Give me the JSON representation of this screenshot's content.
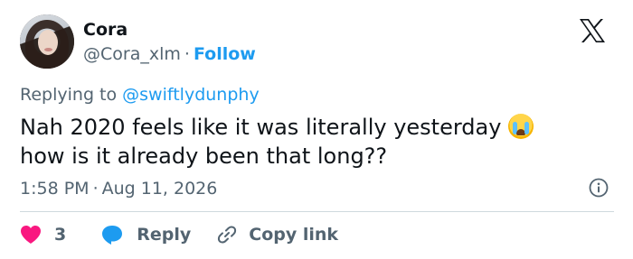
{
  "user": {
    "name": "Cora",
    "handle": "@Cora_xlm",
    "separator": "·",
    "follow_label": "Follow"
  },
  "reply_context": {
    "prefix": "Replying to ",
    "mention": "@swiftlydunphy"
  },
  "tweet": {
    "line1": "Nah 2020 feels like it was literally yesterday",
    "line2": "how is it already been that long??",
    "emoji": "loudly-crying-face"
  },
  "meta": {
    "time": "1:58 PM",
    "separator": "·",
    "date": "Aug 11, 2026"
  },
  "actions": {
    "like_count": "3",
    "reply_label": "Reply",
    "copy_label": "Copy link"
  },
  "colors": {
    "accent": "#1d9bf0",
    "heart": "#f91880",
    "muted": "#536471",
    "text": "#0f1419"
  },
  "icons": [
    "x-logo-icon",
    "info-icon",
    "heart-icon",
    "reply-bubble-icon",
    "link-icon"
  ]
}
